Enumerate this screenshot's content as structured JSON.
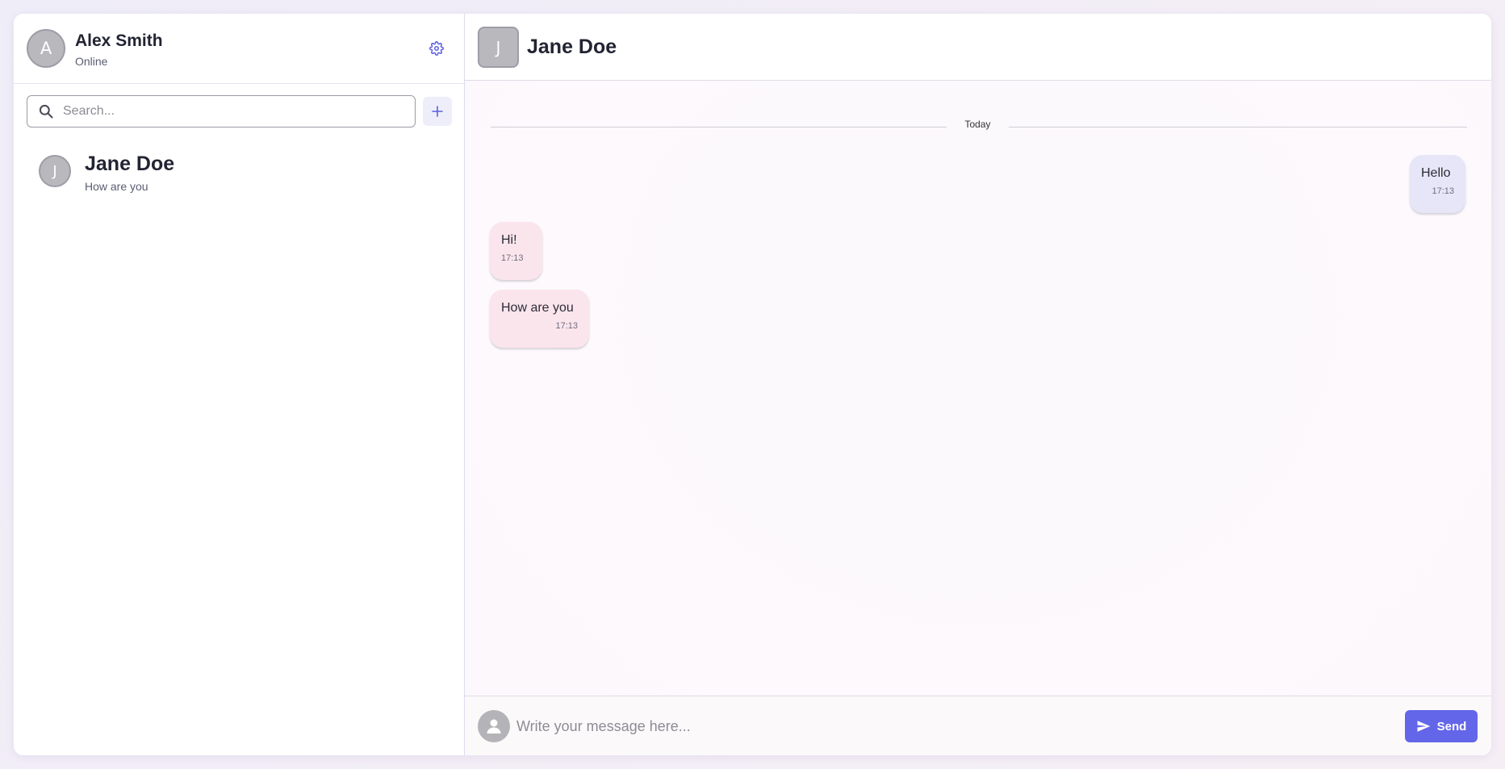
{
  "colors": {
    "accent": "#6366e8",
    "outgoing_bubble": "#e7e6f8",
    "incoming_bubble": "#fbe5ec",
    "avatar": "#b9b9bd"
  },
  "sidebar": {
    "profile": {
      "initial": "A",
      "name": "Alex Smith",
      "status": "Online",
      "settings_icon": "gear-icon"
    },
    "search": {
      "placeholder": "Search...",
      "icon": "search-icon"
    },
    "add_button_icon": "plus-icon",
    "contacts": [
      {
        "initial": "J",
        "name": "Jane Doe",
        "last_message": "How are you"
      }
    ]
  },
  "chat": {
    "header": {
      "initial": "J",
      "name": "Jane Doe"
    },
    "date_divider": "Today",
    "messages": [
      {
        "direction": "outgoing",
        "text": "Hello",
        "time": "17:13"
      },
      {
        "direction": "incoming",
        "text": "Hi!",
        "time": "17:13"
      },
      {
        "direction": "incoming",
        "text": "How are you",
        "time": "17:13"
      }
    ],
    "composer": {
      "avatar_icon": "user-icon",
      "placeholder": "Write your message here...",
      "send_label": "Send",
      "send_icon": "paper-plane-icon"
    }
  }
}
